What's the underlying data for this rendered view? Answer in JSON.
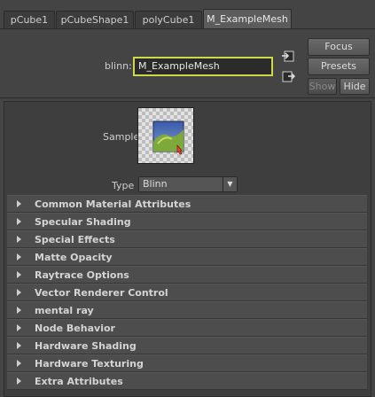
{
  "tabs": [
    {
      "label": "pCube1"
    },
    {
      "label": "pCubeShape1"
    },
    {
      "label": "polyCube1"
    },
    {
      "label": "M_ExampleMesh"
    }
  ],
  "header": {
    "material_type_label": "blinn:",
    "material_name": "M_ExampleMesh",
    "focus_label": "Focus",
    "presets_label": "Presets",
    "show_label": "Show",
    "hide_label": "Hide"
  },
  "sample": {
    "label": "Sample"
  },
  "type": {
    "label": "Type",
    "value": "Blinn"
  },
  "sections": [
    {
      "label": "Common Material Attributes"
    },
    {
      "label": "Specular Shading"
    },
    {
      "label": "Special Effects"
    },
    {
      "label": "Matte Opacity"
    },
    {
      "label": "Raytrace Options"
    },
    {
      "label": "Vector Renderer Control"
    },
    {
      "label": "mental ray"
    },
    {
      "label": "Node Behavior"
    },
    {
      "label": "Hardware Shading"
    },
    {
      "label": "Hardware Texturing"
    },
    {
      "label": "Extra Attributes"
    }
  ],
  "colors": {
    "field_highlight": "#cdd84a",
    "panel_bg": "#3e3e3e",
    "section_bg": "#4d4d4d"
  }
}
